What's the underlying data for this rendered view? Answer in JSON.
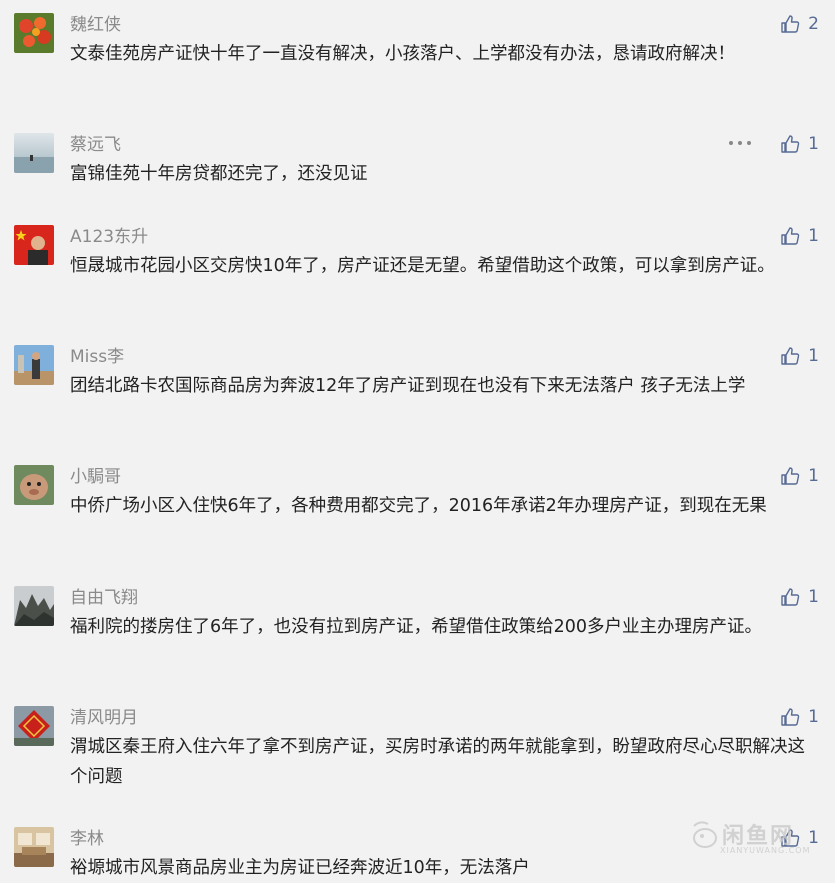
{
  "comments": [
    {
      "name": "魏红侠",
      "text": "文泰佳苑房产证快十年了一直没有解决，小孩落户、上学都没有办法，恳请政府解决！",
      "likes": "2",
      "avatar_icon": "flower-photo-avatar"
    },
    {
      "name": "蔡远飞",
      "text": "富锦佳苑十年房贷都还完了，还没见证",
      "likes": "1",
      "avatar_icon": "misty-lake-avatar"
    },
    {
      "name": "A123东升",
      "text": "恒晟城市花园小区交房快10年了，房产证还是无望。希望借助这个政策，可以拿到房产证。",
      "likes": "1",
      "avatar_icon": "flag-portrait-avatar"
    },
    {
      "name": "Miss李",
      "text": "团结北路卡农国际商品房为奔波12年了房产证到现在也没有下来无法落户  孩子无法上学",
      "likes": "1",
      "avatar_icon": "tourist-photo-avatar"
    },
    {
      "name": "小駶哥",
      "text": "中侨广场小区入住快6年了，各种费用都交完了，2016年承诺2年办理房产证，到现在无果",
      "likes": "1",
      "avatar_icon": "cartoon-avatar"
    },
    {
      "name": "自由飞翔",
      "text": "福利院的搂房住了6年了，也没有拉到房产证，希望借住政策给200多户业主办理房产证。",
      "likes": "1",
      "avatar_icon": "rock-landscape-avatar"
    },
    {
      "name": "清风明月",
      "text": "渭城区秦王府入住六年了拿不到房产证，买房时承诺的两年就能拿到，盼望政府尽心尽职解决这个问题",
      "likes": "1",
      "avatar_icon": "red-decoration-avatar"
    },
    {
      "name": "李林",
      "text": "裕塬城市风景商品房业主为房证已经奔波近10年，无法落户",
      "likes": "1",
      "avatar_icon": "interior-photo-avatar"
    }
  ],
  "watermark": {
    "title": "闲鱼网",
    "subtitle": "XIANYUWANG.COM"
  },
  "colors": {
    "background": "#f2f2f2",
    "name": "#8a8a8a",
    "text": "#222222",
    "like": "#576b95"
  }
}
